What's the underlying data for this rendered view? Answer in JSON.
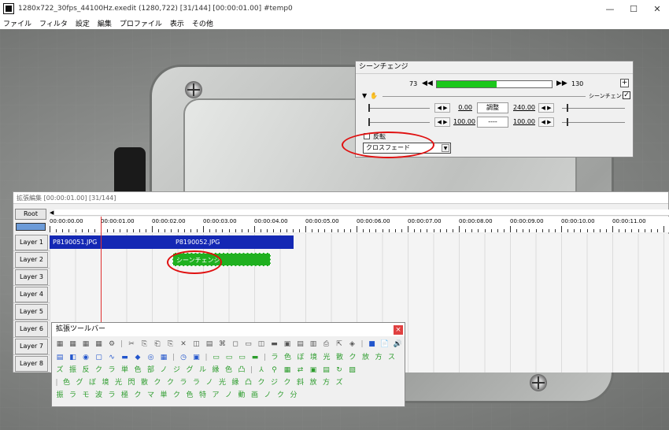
{
  "window": {
    "title": "1280x722_30fps_44100Hz.exedit (1280,722)  [31/144]  [00:00:01.00]  #temp0",
    "controls": [
      "—",
      "☐",
      "✕"
    ]
  },
  "menu": [
    "ファイル",
    "フィルタ",
    "設定",
    "編集",
    "プロファイル",
    "表示",
    "その他"
  ],
  "scene_dialog": {
    "title": "シーンチェンジ",
    "frame_start": "73",
    "frame_end": "130",
    "frame_progress": 0.52,
    "prev_key": "◀◀",
    "next_key": "▶▶",
    "add_label": "+",
    "effect_name": "シーンチェンジ",
    "effect_checked": "✓",
    "params": [
      {
        "arrows_l": "◀ ▶",
        "value_l": "0.00",
        "button": "調整",
        "value_r": "240.00",
        "arrows_r": "◀ ▶"
      },
      {
        "arrows_l": "◀ ▶",
        "value_l": "100.00",
        "button": "----",
        "value_r": "100.00",
        "arrows_r": "◀ ▶"
      }
    ],
    "reverse_label": "反転",
    "transition_value": "クロスフェード",
    "dropdown_arrow": "▼"
  },
  "timeline": {
    "title": "拡張編集 [00:00:01.00] [31/144]",
    "root_label": "Root",
    "scroll_arrow": "◀",
    "time_labels": [
      "00:00:00.00",
      "00:00:01.00",
      "00:00:02.00",
      "00:00:03.00",
      "00:00:04.00",
      "00:00:05.00",
      "00:00:06.00",
      "00:00:07.00",
      "00:00:08.00",
      "00:00:09.00",
      "00:00:10.00",
      "00:00:11.00"
    ],
    "layers": [
      "Layer 1",
      "Layer 2",
      "Layer 3",
      "Layer 4",
      "Layer 5",
      "Layer 6",
      "Layer 7",
      "Layer 8"
    ],
    "clip1": "P8190051.JPG",
    "clip2": "P8190052.JPG",
    "scene_clip": "シーンチェンジ"
  },
  "toolbar": {
    "title": "拡張ツールバー",
    "close": "×",
    "row1": [
      "▦",
      "▦",
      "▦",
      "▦",
      "⚙",
      "|",
      "✂",
      "⎘",
      "⎗",
      "⎘",
      "✕",
      "◫",
      "▤",
      "⌘",
      "◻",
      "▭",
      "◫",
      "▬",
      "▣",
      "▤",
      "▥",
      "⎙",
      "⇱",
      "◈",
      "|",
      "■",
      "📄",
      "🔊"
    ],
    "row2": [
      "▤",
      "◧",
      "◉",
      "▢",
      "∿",
      "▬",
      "◆",
      "◎",
      "▦",
      "|",
      "◷",
      "▣",
      "|",
      "▭",
      "▭",
      "▭",
      "▬",
      "|",
      "ラ",
      "色",
      "ぼ",
      "境",
      "光",
      "散",
      "ク",
      "放",
      "方",
      "ス"
    ],
    "row3": [
      "ズ",
      "振",
      "反",
      "ク",
      "ラ",
      "単",
      "色",
      "部",
      "ノ",
      "ジ",
      "グ",
      "ル",
      "縁",
      "色",
      "凸",
      "|",
      "⅄",
      "⚲",
      "▦",
      "⇄",
      "▣",
      "▤",
      "↻",
      "▧"
    ],
    "row4": [
      "|",
      "色",
      "グ",
      "ぼ",
      "境",
      "光",
      "閃",
      "散",
      "ク",
      "ク",
      "ラ",
      "ラ",
      "ノ",
      "光",
      "縁",
      "凸",
      "ク",
      "ジ",
      "ク",
      "斜",
      "放",
      "方",
      "ズ"
    ],
    "row5": [
      "振",
      "ラ",
      "モ",
      "波",
      "ラ",
      "極",
      "ク",
      "マ",
      "単",
      "ク",
      "色",
      "特",
      "ア",
      "ノ",
      "動",
      "画",
      "ノ",
      "ク",
      "分"
    ]
  }
}
